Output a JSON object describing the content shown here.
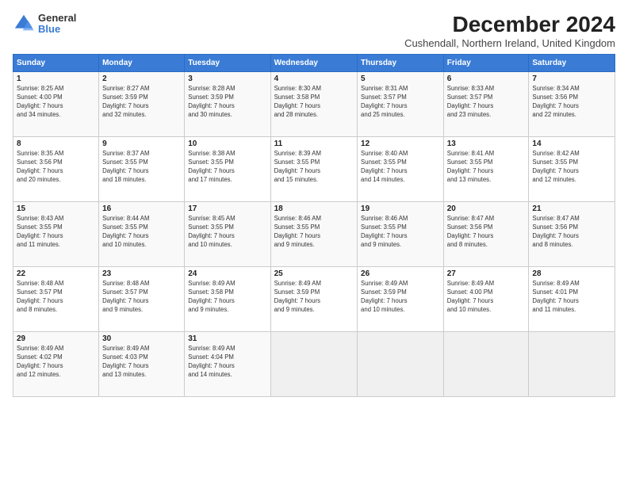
{
  "logo": {
    "general": "General",
    "blue": "Blue"
  },
  "header": {
    "title": "December 2024",
    "subtitle": "Cushendall, Northern Ireland, United Kingdom"
  },
  "weekdays": [
    "Sunday",
    "Monday",
    "Tuesday",
    "Wednesday",
    "Thursday",
    "Friday",
    "Saturday"
  ],
  "weeks": [
    [
      {
        "day": "1",
        "sunrise": "8:25 AM",
        "sunset": "4:00 PM",
        "daylight": "7 hours and 34 minutes."
      },
      {
        "day": "2",
        "sunrise": "8:27 AM",
        "sunset": "3:59 PM",
        "daylight": "7 hours and 32 minutes."
      },
      {
        "day": "3",
        "sunrise": "8:28 AM",
        "sunset": "3:59 PM",
        "daylight": "7 hours and 30 minutes."
      },
      {
        "day": "4",
        "sunrise": "8:30 AM",
        "sunset": "3:58 PM",
        "daylight": "7 hours and 28 minutes."
      },
      {
        "day": "5",
        "sunrise": "8:31 AM",
        "sunset": "3:57 PM",
        "daylight": "7 hours and 25 minutes."
      },
      {
        "day": "6",
        "sunrise": "8:33 AM",
        "sunset": "3:57 PM",
        "daylight": "7 hours and 23 minutes."
      },
      {
        "day": "7",
        "sunrise": "8:34 AM",
        "sunset": "3:56 PM",
        "daylight": "7 hours and 22 minutes."
      }
    ],
    [
      {
        "day": "8",
        "sunrise": "8:35 AM",
        "sunset": "3:56 PM",
        "daylight": "7 hours and 20 minutes."
      },
      {
        "day": "9",
        "sunrise": "8:37 AM",
        "sunset": "3:55 PM",
        "daylight": "7 hours and 18 minutes."
      },
      {
        "day": "10",
        "sunrise": "8:38 AM",
        "sunset": "3:55 PM",
        "daylight": "7 hours and 17 minutes."
      },
      {
        "day": "11",
        "sunrise": "8:39 AM",
        "sunset": "3:55 PM",
        "daylight": "7 hours and 15 minutes."
      },
      {
        "day": "12",
        "sunrise": "8:40 AM",
        "sunset": "3:55 PM",
        "daylight": "7 hours and 14 minutes."
      },
      {
        "day": "13",
        "sunrise": "8:41 AM",
        "sunset": "3:55 PM",
        "daylight": "7 hours and 13 minutes."
      },
      {
        "day": "14",
        "sunrise": "8:42 AM",
        "sunset": "3:55 PM",
        "daylight": "7 hours and 12 minutes."
      }
    ],
    [
      {
        "day": "15",
        "sunrise": "8:43 AM",
        "sunset": "3:55 PM",
        "daylight": "7 hours and 11 minutes."
      },
      {
        "day": "16",
        "sunrise": "8:44 AM",
        "sunset": "3:55 PM",
        "daylight": "7 hours and 10 minutes."
      },
      {
        "day": "17",
        "sunrise": "8:45 AM",
        "sunset": "3:55 PM",
        "daylight": "7 hours and 10 minutes."
      },
      {
        "day": "18",
        "sunrise": "8:46 AM",
        "sunset": "3:55 PM",
        "daylight": "7 hours and 9 minutes."
      },
      {
        "day": "19",
        "sunrise": "8:46 AM",
        "sunset": "3:55 PM",
        "daylight": "7 hours and 9 minutes."
      },
      {
        "day": "20",
        "sunrise": "8:47 AM",
        "sunset": "3:56 PM",
        "daylight": "7 hours and 8 minutes."
      },
      {
        "day": "21",
        "sunrise": "8:47 AM",
        "sunset": "3:56 PM",
        "daylight": "7 hours and 8 minutes."
      }
    ],
    [
      {
        "day": "22",
        "sunrise": "8:48 AM",
        "sunset": "3:57 PM",
        "daylight": "7 hours and 8 minutes."
      },
      {
        "day": "23",
        "sunrise": "8:48 AM",
        "sunset": "3:57 PM",
        "daylight": "7 hours and 9 minutes."
      },
      {
        "day": "24",
        "sunrise": "8:49 AM",
        "sunset": "3:58 PM",
        "daylight": "7 hours and 9 minutes."
      },
      {
        "day": "25",
        "sunrise": "8:49 AM",
        "sunset": "3:59 PM",
        "daylight": "7 hours and 9 minutes."
      },
      {
        "day": "26",
        "sunrise": "8:49 AM",
        "sunset": "3:59 PM",
        "daylight": "7 hours and 10 minutes."
      },
      {
        "day": "27",
        "sunrise": "8:49 AM",
        "sunset": "4:00 PM",
        "daylight": "7 hours and 10 minutes."
      },
      {
        "day": "28",
        "sunrise": "8:49 AM",
        "sunset": "4:01 PM",
        "daylight": "7 hours and 11 minutes."
      }
    ],
    [
      {
        "day": "29",
        "sunrise": "8:49 AM",
        "sunset": "4:02 PM",
        "daylight": "7 hours and 12 minutes."
      },
      {
        "day": "30",
        "sunrise": "8:49 AM",
        "sunset": "4:03 PM",
        "daylight": "7 hours and 13 minutes."
      },
      {
        "day": "31",
        "sunrise": "8:49 AM",
        "sunset": "4:04 PM",
        "daylight": "7 hours and 14 minutes."
      },
      null,
      null,
      null,
      null
    ]
  ]
}
